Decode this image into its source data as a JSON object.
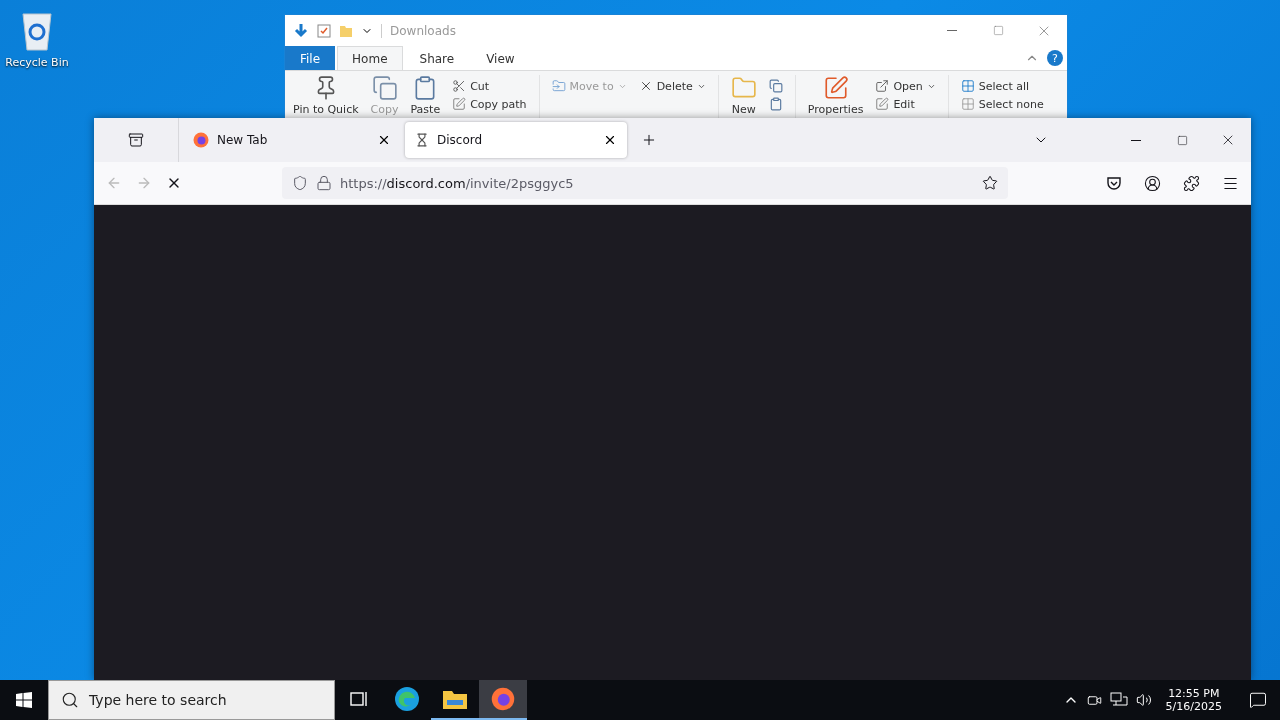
{
  "desktop_icons": [
    {
      "label": "Recycle Bin"
    }
  ],
  "explorer": {
    "title": "Downloads",
    "tabs": [
      {
        "label": "File",
        "kind": "file",
        "selected": false
      },
      {
        "label": "Home",
        "kind": "tab",
        "selected": true
      },
      {
        "label": "Share",
        "kind": "tab",
        "selected": false
      },
      {
        "label": "View",
        "kind": "tab",
        "selected": false
      }
    ],
    "help": "?",
    "ribbon": [
      {
        "kind": "large",
        "label": "Pin to Quick"
      },
      {
        "kind": "large",
        "label": "Copy",
        "disabled": true
      },
      {
        "kind": "large",
        "label": "Paste"
      },
      {
        "kind": "small",
        "items": [
          {
            "label": "Cut"
          },
          {
            "label": "Copy path"
          }
        ]
      },
      {
        "kind": "sep"
      },
      {
        "kind": "small",
        "items": [
          {
            "label": "Move to",
            "disabled": true
          }
        ]
      },
      {
        "kind": "small",
        "items": [
          {
            "label": "Delete"
          }
        ]
      },
      {
        "kind": "sep"
      },
      {
        "kind": "large",
        "label": "New"
      },
      {
        "kind": "icons"
      },
      {
        "kind": "sep"
      },
      {
        "kind": "large",
        "label": "Properties"
      },
      {
        "kind": "small",
        "items": [
          {
            "label": "Open"
          },
          {
            "label": "Edit"
          }
        ]
      },
      {
        "kind": "sep"
      },
      {
        "kind": "small",
        "items": [
          {
            "label": "Select all"
          },
          {
            "label": "Select none"
          }
        ]
      }
    ]
  },
  "browser": {
    "tabs": [
      {
        "label": "New Tab",
        "selected": false
      },
      {
        "label": "Discord",
        "selected": true
      }
    ],
    "url": {
      "scheme": "https://",
      "host": "discord.com",
      "path": "/invite/2psggyc5"
    }
  },
  "taskbar": {
    "search_placeholder": "Type here to search",
    "apps": [
      {
        "kind": "edge",
        "running": false,
        "selected": false
      },
      {
        "kind": "explorer",
        "running": true,
        "selected": false
      },
      {
        "kind": "firefox",
        "running": true,
        "selected": true
      }
    ],
    "time": "12:55 PM",
    "date": "5/16/2025"
  }
}
